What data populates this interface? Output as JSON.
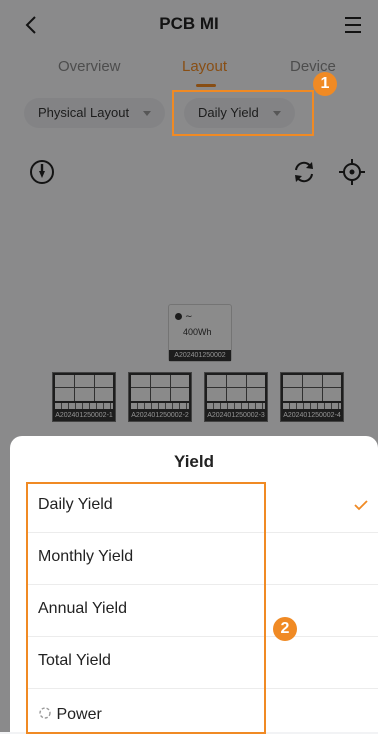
{
  "header": {
    "title": "PCB MI"
  },
  "tabs": [
    {
      "label": "Overview"
    },
    {
      "label": "Layout",
      "active": true
    },
    {
      "label": "Device"
    }
  ],
  "filters": {
    "layout": {
      "label": "Physical Layout"
    },
    "metric": {
      "label": "Daily Yield"
    }
  },
  "callouts": {
    "one": "1",
    "two": "2"
  },
  "device": {
    "power": "400Wh",
    "serial": "A202401250002"
  },
  "panels": [
    {
      "serial": "A202401250002-1"
    },
    {
      "serial": "A202401250002-2"
    },
    {
      "serial": "A202401250002-3"
    },
    {
      "serial": "A202401250002-4"
    }
  ],
  "sheet": {
    "title": "Yield",
    "options": [
      {
        "label": "Daily Yield",
        "selected": true
      },
      {
        "label": "Monthly Yield"
      },
      {
        "label": "Annual Yield"
      },
      {
        "label": "Total Yield"
      },
      {
        "label": "Power"
      }
    ]
  },
  "colors": {
    "accent": "#f08a24",
    "overlay": "rgba(0,0,0,0.43)"
  },
  "icons": {
    "back": "chevron-left-icon",
    "menu": "hamburger-menu-icon",
    "power": "power-icon",
    "refresh": "refresh-icon",
    "locate": "crosshair-icon",
    "check": "checkmark-icon",
    "power_option": "power-loading-icon"
  }
}
